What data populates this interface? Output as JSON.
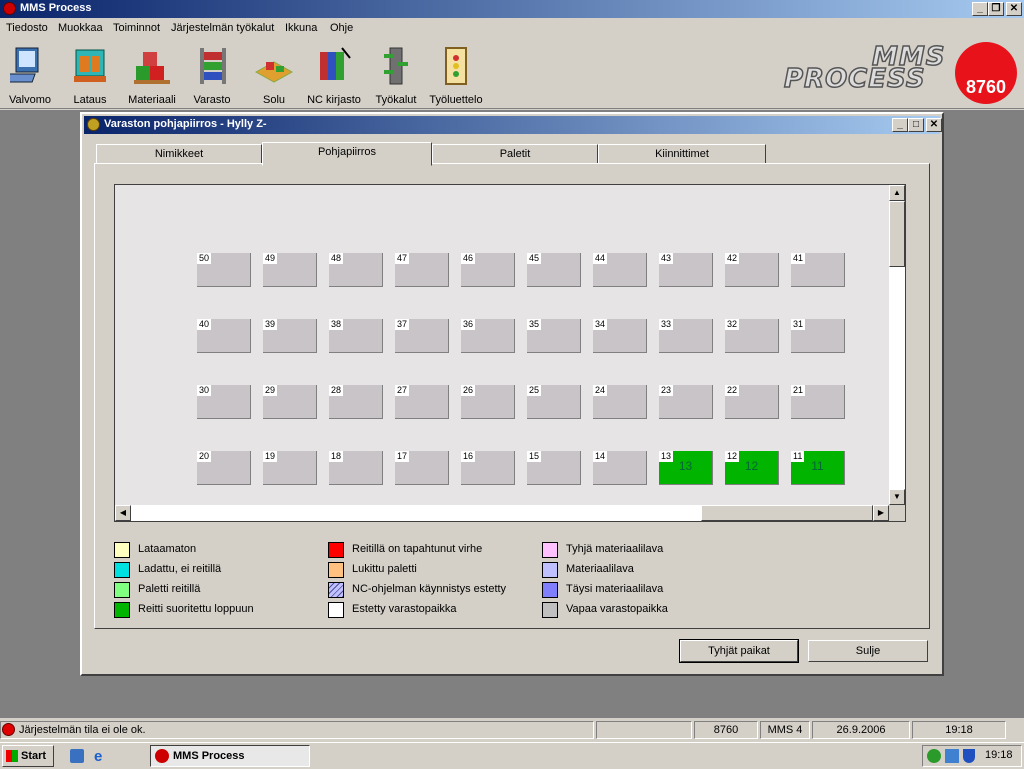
{
  "app": {
    "title": "MMS Process"
  },
  "menu": [
    "Tiedosto",
    "Muokkaa",
    "Toiminnot",
    "Järjestelmän työkalut",
    "Ikkuna",
    "Ohje"
  ],
  "toolbar": [
    "Valvomo",
    "Lataus",
    "Materiaali",
    "Varasto",
    "Solu",
    "NC kirjasto",
    "Työkalut",
    "Työluettelo"
  ],
  "brand": {
    "line1": "MMS",
    "line2": "PROCESS",
    "badge": "8760",
    "badge_color": "#e8131a"
  },
  "window": {
    "title": "Varaston pohjapiirros  -  Hylly Z-"
  },
  "tabs": [
    "Nimikkeet",
    "Pohjapiirros",
    "Paletit",
    "Kiinnittimet"
  ],
  "active_tab": "Pohjapiirros",
  "slots": {
    "rows": [
      [
        50,
        49,
        48,
        47,
        46,
        45,
        44,
        43,
        42,
        41
      ],
      [
        40,
        39,
        38,
        37,
        36,
        35,
        34,
        33,
        32,
        31
      ],
      [
        30,
        29,
        28,
        27,
        26,
        25,
        24,
        23,
        22,
        21
      ],
      [
        20,
        19,
        18,
        17,
        16,
        15,
        14,
        13,
        12,
        11
      ]
    ],
    "occupied": [
      {
        "slot": 13,
        "pallet": "13",
        "status": "Reitti suoritettu loppuun"
      },
      {
        "slot": 12,
        "pallet": "12",
        "status": "Reitti suoritettu loppuun"
      },
      {
        "slot": 11,
        "pallet": "11",
        "status": "Reitti suoritettu loppuun"
      }
    ],
    "free_color": "#c8c4c8",
    "done_color": "#00b400"
  },
  "legend": [
    {
      "label": "Lataamaton",
      "color": "#ffffc0"
    },
    {
      "label": "Ladattu, ei reitillä",
      "color": "#00e0e0"
    },
    {
      "label": "Paletti reitillä",
      "color": "#80ff80"
    },
    {
      "label": "Reitti suoritettu loppuun",
      "color": "#00b400"
    },
    {
      "label": "Reitillä on tapahtunut virhe",
      "color": "#ff0000"
    },
    {
      "label": "Lukittu paletti",
      "color": "#ffc080"
    },
    {
      "label": "NC-ohjelman käynnistys estetty",
      "color": "hatched"
    },
    {
      "label": "Estetty varastopaikka",
      "color": "#ffffff"
    },
    {
      "label": "Tyhjä materiaalilava",
      "color": "#ffc0ff"
    },
    {
      "label": "Materiaalilava",
      "color": "#c0c0ff"
    },
    {
      "label": "Täysi materiaalilava",
      "color": "#8080ff"
    },
    {
      "label": "Vapaa varastopaikka",
      "color": "#c0c0c0"
    }
  ],
  "buttons": {
    "empty_slots": "Tyhjät paikat",
    "close": "Sulje"
  },
  "status": {
    "message": "Järjestelmän tila ei ole ok.",
    "system": "8760",
    "version": "MMS 4",
    "date": "26.9.2006",
    "time": "19:18"
  },
  "taskbar": {
    "start": "Start",
    "task": "MMS Process",
    "clock": "19:18"
  }
}
